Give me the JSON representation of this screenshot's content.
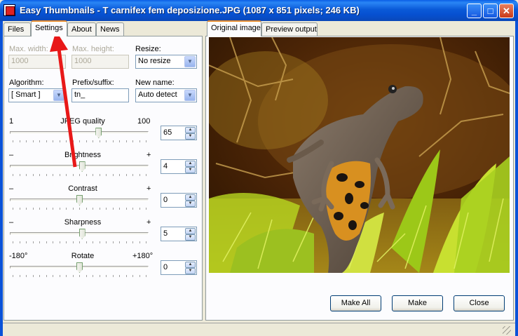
{
  "window": {
    "title": "Easy Thumbnails - T carnifex fem deposizione.JPG  (1087 x 851 pixels;  246 KB)",
    "controls": [
      "minimize",
      "maximize",
      "close"
    ]
  },
  "left_tabs": [
    {
      "label": "Files",
      "active": false
    },
    {
      "label": "Settings",
      "active": true
    },
    {
      "label": "About",
      "active": false
    },
    {
      "label": "News",
      "active": false
    }
  ],
  "settings": {
    "max_width": {
      "label": "Max. width:",
      "value": "1000",
      "enabled": false
    },
    "max_height": {
      "label": "Max. height:",
      "value": "1000",
      "enabled": false
    },
    "resize": {
      "label": "Resize:",
      "value": "No resize"
    },
    "algorithm": {
      "label": "Algorithm:",
      "value": "[ Smart ]"
    },
    "prefix": {
      "label": "Prefix/suffix:",
      "value": "tn_"
    },
    "new_name": {
      "label": "New name:",
      "value": "Auto detect"
    },
    "sliders": [
      {
        "name": "JPEG quality",
        "min_label": "1",
        "max_label": "100",
        "value": "65",
        "level": 0.65
      },
      {
        "name": "Brightness",
        "min_label": "–",
        "max_label": "+",
        "value": "4",
        "level": 0.52
      },
      {
        "name": "Contrast",
        "min_label": "–",
        "max_label": "+",
        "value": "0",
        "level": 0.5
      },
      {
        "name": "Sharpness",
        "min_label": "–",
        "max_label": "+",
        "value": "5",
        "level": 0.52
      },
      {
        "name": "Rotate",
        "min_label": "-180°",
        "max_label": "+180°",
        "value": "0",
        "level": 0.5
      }
    ]
  },
  "right_tabs": [
    {
      "label": "Original image",
      "active": true
    },
    {
      "label": "Preview output",
      "active": false
    }
  ],
  "buttons": {
    "make_all": "Make All",
    "make": "Make",
    "close": "Close"
  },
  "colors": {
    "titlebar": "#0a58d8",
    "annotation_arrow": "#e81818",
    "tab_highlight": "#e68b2c"
  }
}
